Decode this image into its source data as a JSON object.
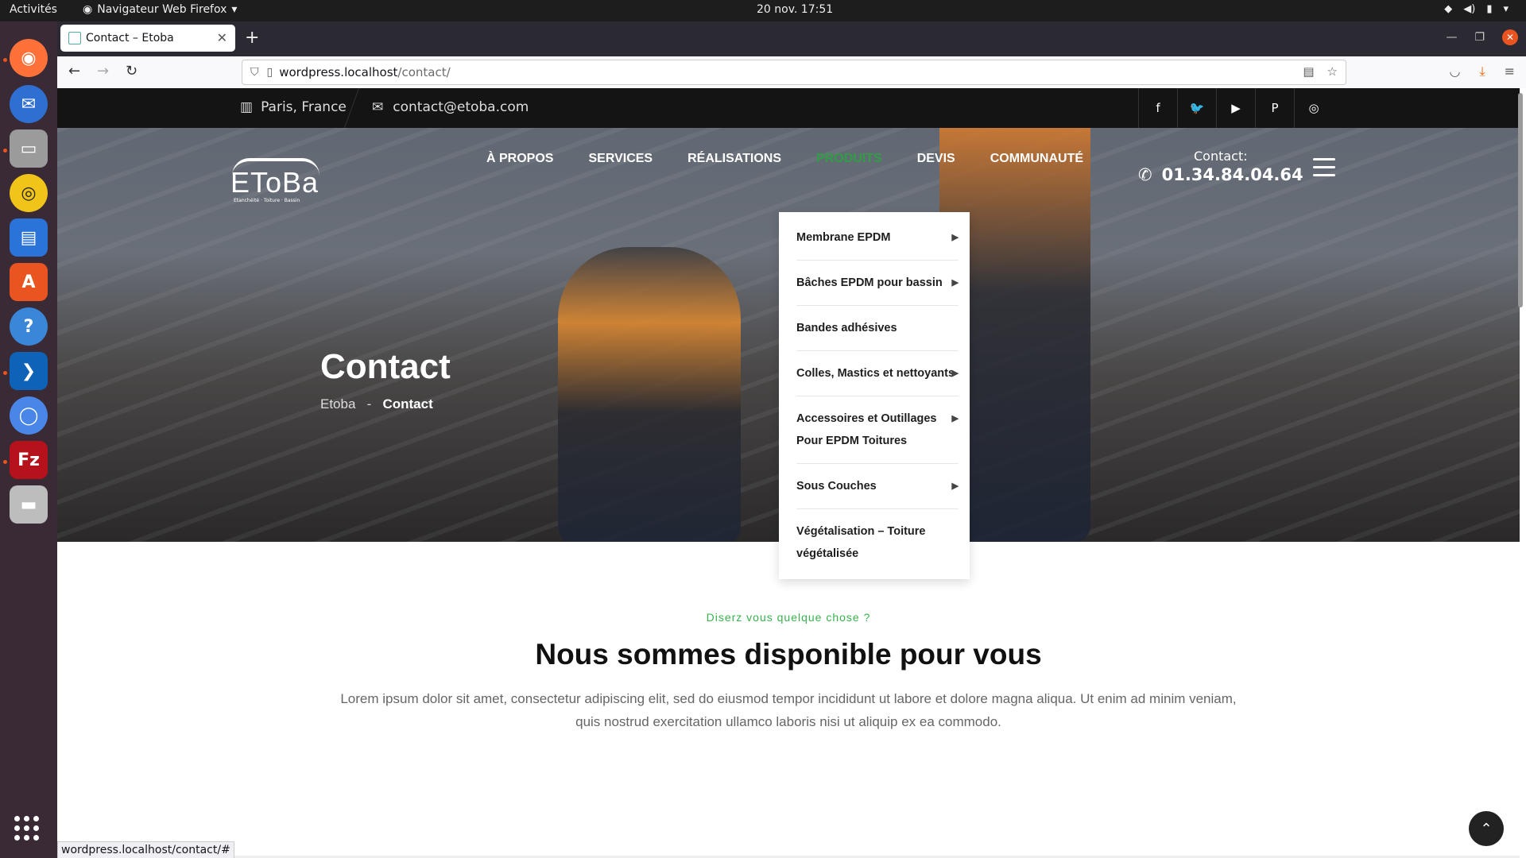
{
  "topbar": {
    "activities": "Activités",
    "app_name": "Navigateur Web Firefox",
    "clock": "20 nov.  17:51"
  },
  "browser": {
    "tab_title": "Contact – Etoba",
    "url_host": "wordpress.localhost",
    "url_path": "/contact/",
    "status_url": "wordpress.localhost/contact/#"
  },
  "site": {
    "location": "Paris, France",
    "email": "contact@etoba.com",
    "logo_text": "EToBa",
    "logo_tagline": "Etanchéité · Toiture · Bassin",
    "menu": [
      {
        "label": "À PROPOS"
      },
      {
        "label": "SERVICES"
      },
      {
        "label": "RÉALISATIONS"
      },
      {
        "label": "PRODUITS"
      },
      {
        "label": "DEVIS"
      },
      {
        "label": "COMMUNAUTÉ"
      }
    ],
    "contact_label": "Contact:",
    "contact_phone": "01.34.84.04.64",
    "hero_title": "Contact",
    "breadcrumb_home": "Etoba",
    "breadcrumb_sep": "-",
    "breadcrumb_current": "Contact"
  },
  "dropdown": [
    {
      "label": "Membrane EPDM",
      "arrow": "▶"
    },
    {
      "label": "Bâches EPDM pour bassin",
      "arrow": "▶"
    },
    {
      "label": "Bandes adhésives",
      "arrow": ""
    },
    {
      "label": "Colles, Mastics et nettoyants",
      "arrow": "▶"
    },
    {
      "label": "Accessoires et Outillages Pour EPDM Toitures",
      "arrow": "▶"
    },
    {
      "label": "Sous Couches",
      "arrow": "▶"
    },
    {
      "label": "Végétalisation – Toiture végétalisée",
      "arrow": ""
    }
  ],
  "content": {
    "subtitle": "Diserz vous quelque chose ?",
    "heading": "Nous sommes disponible pour vous",
    "lead": "Lorem ipsum dolor sit amet, consectetur adipiscing elit, sed do eiusmod tempor incididunt ut labore et dolore magna aliqua. Ut enim ad minim veniam, quis nostrud exercitation ullamco laboris nisi ut aliquip ex ea commodo."
  },
  "colors": {
    "accent_green": "#37b24d",
    "dark": "#141414",
    "firefox_bg": "#2b2a33",
    "ubuntu_orange": "#e95420"
  },
  "icons": {
    "back": "arrow-left-icon",
    "forward": "arrow-right-icon",
    "reload": "reload-icon",
    "map": "map-icon",
    "mail": "envelope-icon",
    "phone": "phone-icon"
  }
}
